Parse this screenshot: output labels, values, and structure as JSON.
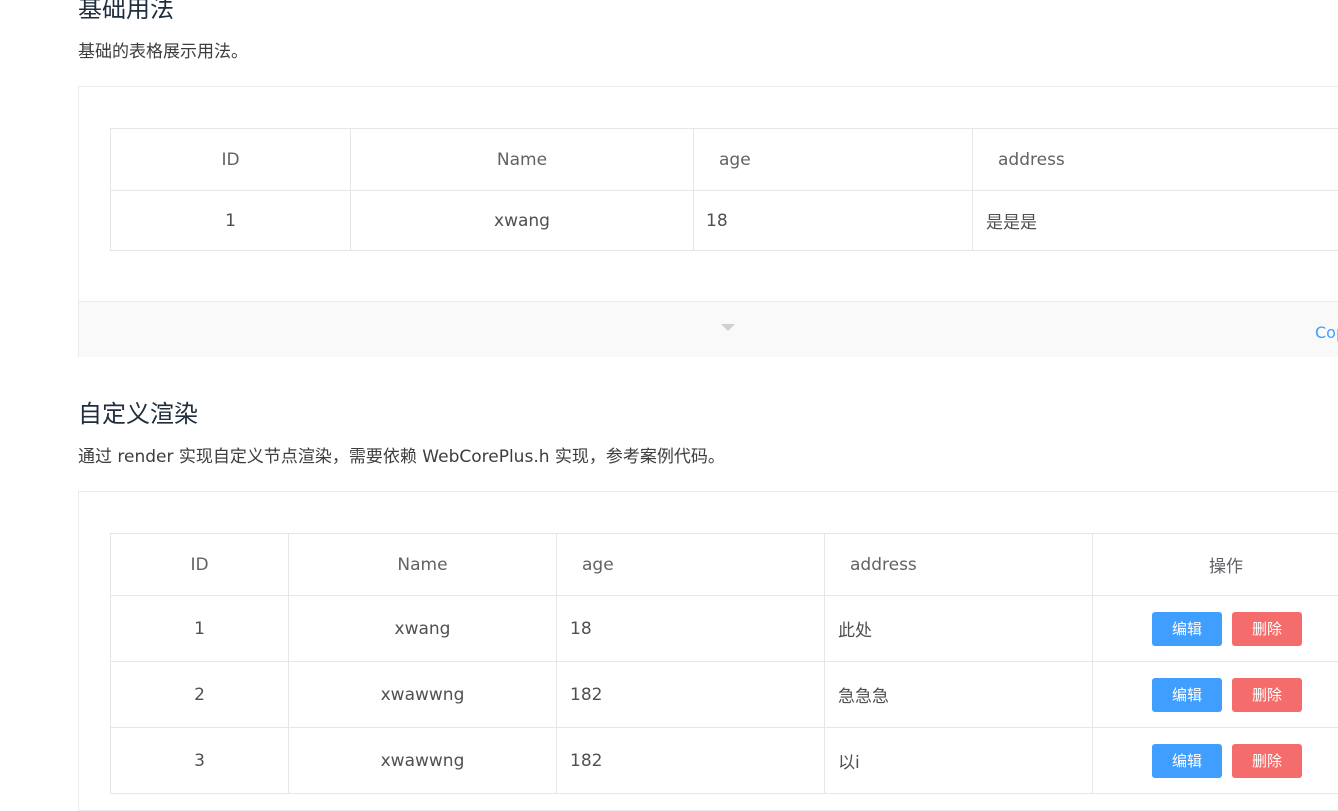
{
  "section1": {
    "title": "基础用法",
    "description": "基础的表格展示用法。",
    "table": {
      "headers": [
        "ID",
        "Name",
        "age",
        "address"
      ],
      "rows": [
        [
          "1",
          "xwang",
          "18",
          "是是是"
        ]
      ]
    },
    "copy_label": "Cop"
  },
  "section2": {
    "title": "自定义渲染",
    "description": "通过 render 实现自定义节点渲染，需要依赖 WebCorePlus.h 实现，参考案例代码。",
    "table": {
      "headers": [
        "ID",
        "Name",
        "age",
        "address",
        "操作"
      ],
      "rows": [
        [
          "1",
          "xwang",
          "18",
          "此处"
        ],
        [
          "2",
          "xwawwng",
          "182",
          "急急急"
        ],
        [
          "3",
          "xwawwng",
          "182",
          "以i"
        ]
      ],
      "edit_label": "编辑",
      "delete_label": "删除"
    }
  },
  "colors": {
    "primary": "#409eff",
    "danger": "#f56c6c",
    "border": "#e6e6e6"
  }
}
